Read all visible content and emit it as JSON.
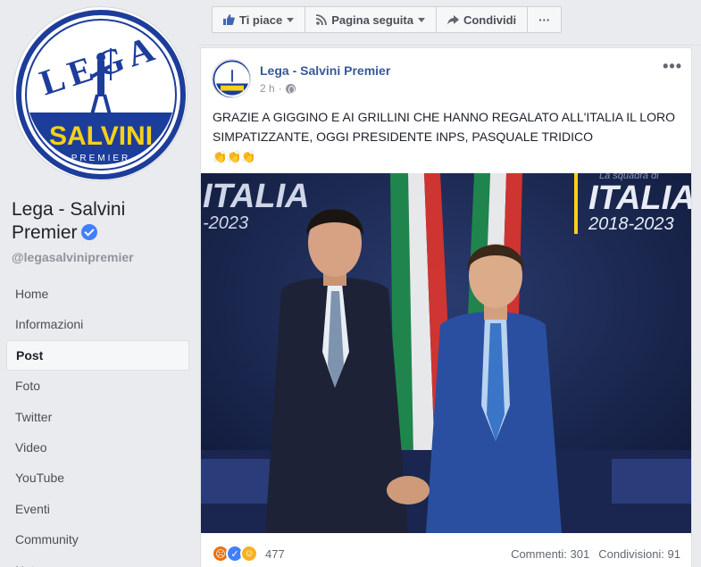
{
  "page": {
    "name": "Lega - Salvini Premier",
    "handle": "@legasalvinipremier",
    "logo": {
      "top_text": "LEGA",
      "main_text": "SALVINI",
      "sub_text": "PREMIER"
    }
  },
  "nav": {
    "items": [
      {
        "label": "Home"
      },
      {
        "label": "Informazioni"
      },
      {
        "label": "Post",
        "active": true
      },
      {
        "label": "Foto"
      },
      {
        "label": "Twitter"
      },
      {
        "label": "Video"
      },
      {
        "label": "YouTube"
      },
      {
        "label": "Eventi"
      },
      {
        "label": "Community"
      },
      {
        "label": "Note"
      }
    ]
  },
  "actionbar": {
    "like": "Ti piace",
    "follow": "Pagina seguita",
    "share": "Condividi",
    "more": "···"
  },
  "post": {
    "author": "Lega - Salvini Premier",
    "time": "2 h",
    "separator": "·",
    "text": "GRAZIE A GIGGINO E AI GRILLINI CHE HANNO REGALATO ALL'ITALIA IL LORO SIMPATIZZANTE, OGGI PRESIDENTE INPS, PASQUALE TRIDICO",
    "emoji": "👏👏👏",
    "photo": {
      "backdrop_left": "ITALIA",
      "backdrop_left_years": "-2023",
      "backdrop_right": "ITALIA",
      "backdrop_right_years": "2018-2023",
      "backdrop_tag": "La squadra di"
    },
    "reactions": {
      "count": "477",
      "types": [
        "angry-icon",
        "like-icon",
        "haha-icon"
      ]
    },
    "comments": "Commenti: 301",
    "shares": "Condivisioni: 91"
  },
  "colors": {
    "brand_blue": "#1d3d9b",
    "brand_yellow": "#f7d117",
    "link": "#385898"
  }
}
